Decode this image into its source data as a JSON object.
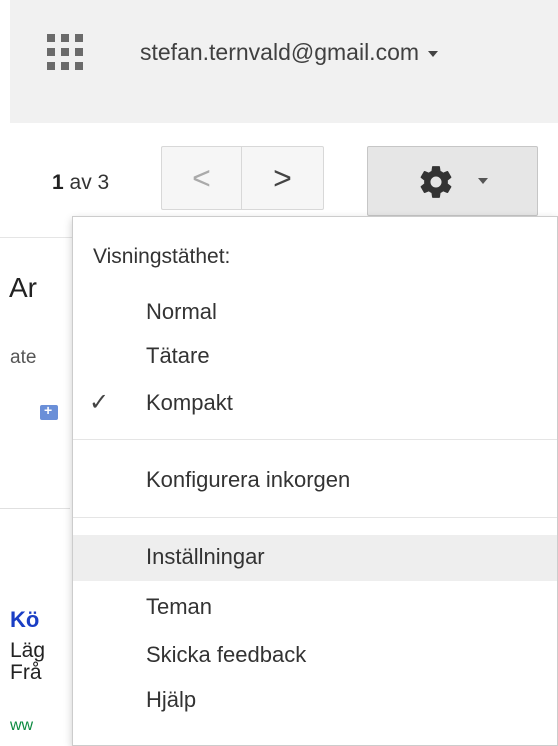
{
  "header": {
    "account_email": "stefan.ternvald@gmail.com",
    "apps_icon": "apps-grid-icon",
    "account_caret_icon": "chevron-down-icon"
  },
  "toolbar": {
    "page_current": "1",
    "page_of_total": " av 3",
    "prev_icon": "chevron-left-icon",
    "prev_glyph": "<",
    "next_icon": "chevron-right-icon",
    "next_glyph": ">",
    "settings_icon": "gear-icon"
  },
  "background": {
    "title_fragment": "Ar",
    "sub_fragment": "ate",
    "ad_title_fragment": "Kö",
    "ad_line1_fragment": "Läg",
    "ad_line2_fragment": "Frå",
    "ad_url_fragment": "ww"
  },
  "settings_menu": {
    "density_heading": "Visningstäthet:",
    "density_options": [
      {
        "label": "Normal",
        "checked": false
      },
      {
        "label": "Tätare",
        "checked": false
      },
      {
        "label": "Kompakt",
        "checked": true
      }
    ],
    "check_glyph": "✓",
    "configure_inbox": "Konfigurera inkorgen",
    "settings": "Inställningar",
    "themes": "Teman",
    "send_feedback": "Skicka feedback",
    "help": "Hjälp"
  },
  "colors": {
    "top_bar": "#f1f1f1",
    "menu_hover": "#eeeeee",
    "ad_link": "#1a3ec4",
    "ad_url": "#0b8a3f"
  }
}
